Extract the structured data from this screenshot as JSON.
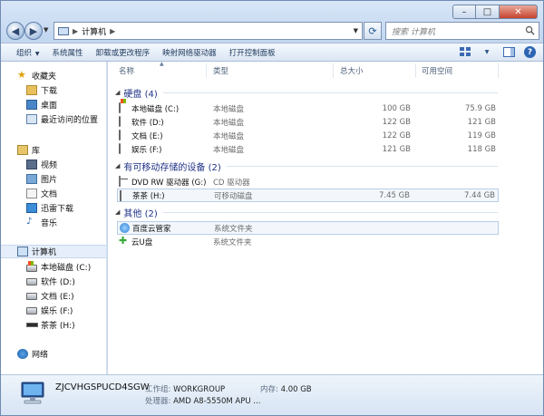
{
  "window": {
    "controls": {
      "min": "–",
      "max": "□",
      "close": "✕"
    }
  },
  "nav": {
    "address_text": "计算机",
    "search_placeholder": "搜索 计算机"
  },
  "toolbar": {
    "items": [
      "组织",
      "系统属性",
      "卸载或更改程序",
      "映射网络驱动器",
      "打开控制面板"
    ]
  },
  "sidebar": {
    "favorites_header": "收藏夹",
    "favorites": [
      "下载",
      "桌面",
      "最近访问的位置"
    ],
    "libraries_header": "库",
    "libraries": [
      "视频",
      "图片",
      "文档",
      "迅雷下载",
      "音乐"
    ],
    "computer_header": "计算机",
    "computer_items": [
      "本地磁盘 (C:)",
      "软件 (D:)",
      "文档 (E:)",
      "娱乐 (F:)",
      "茶茶 (H:)"
    ],
    "network_header": "网络"
  },
  "columns": {
    "name": "名称",
    "type": "类型",
    "total": "总大小",
    "free": "可用空间"
  },
  "groups": {
    "hdd": "硬盘 (4)",
    "removable": "有可移动存储的设备 (2)",
    "other": "其他 (2)"
  },
  "hdd_rows": [
    {
      "name": "本地磁盘 (C:)",
      "type": "本地磁盘",
      "total": "100 GB",
      "free": "75.9 GB"
    },
    {
      "name": "软件 (D:)",
      "type": "本地磁盘",
      "total": "122 GB",
      "free": "121 GB"
    },
    {
      "name": "文档 (E:)",
      "type": "本地磁盘",
      "total": "122 GB",
      "free": "119 GB"
    },
    {
      "name": "娱乐 (F:)",
      "type": "本地磁盘",
      "total": "121 GB",
      "free": "118 GB"
    }
  ],
  "removable_rows": [
    {
      "name": "DVD RW 驱动器 (G:)",
      "type": "CD 驱动器",
      "total": "",
      "free": ""
    },
    {
      "name": "茶茶 (H:)",
      "type": "可移动磁盘",
      "total": "7.45 GB",
      "free": "7.44 GB"
    }
  ],
  "other_rows": [
    {
      "name": "百度云管家",
      "type": "系统文件夹"
    },
    {
      "name": "云U盘",
      "type": "系统文件夹"
    }
  ],
  "details": {
    "computer_name": "ZJCVHGSPUCD4SGW",
    "workgroup_label": "工作组:",
    "workgroup_value": "WORKGROUP",
    "memory_label": "内存:",
    "memory_value": "4.00 GB",
    "cpu_label": "处理器:",
    "cpu_value": "AMD A8-5550M APU ..."
  }
}
